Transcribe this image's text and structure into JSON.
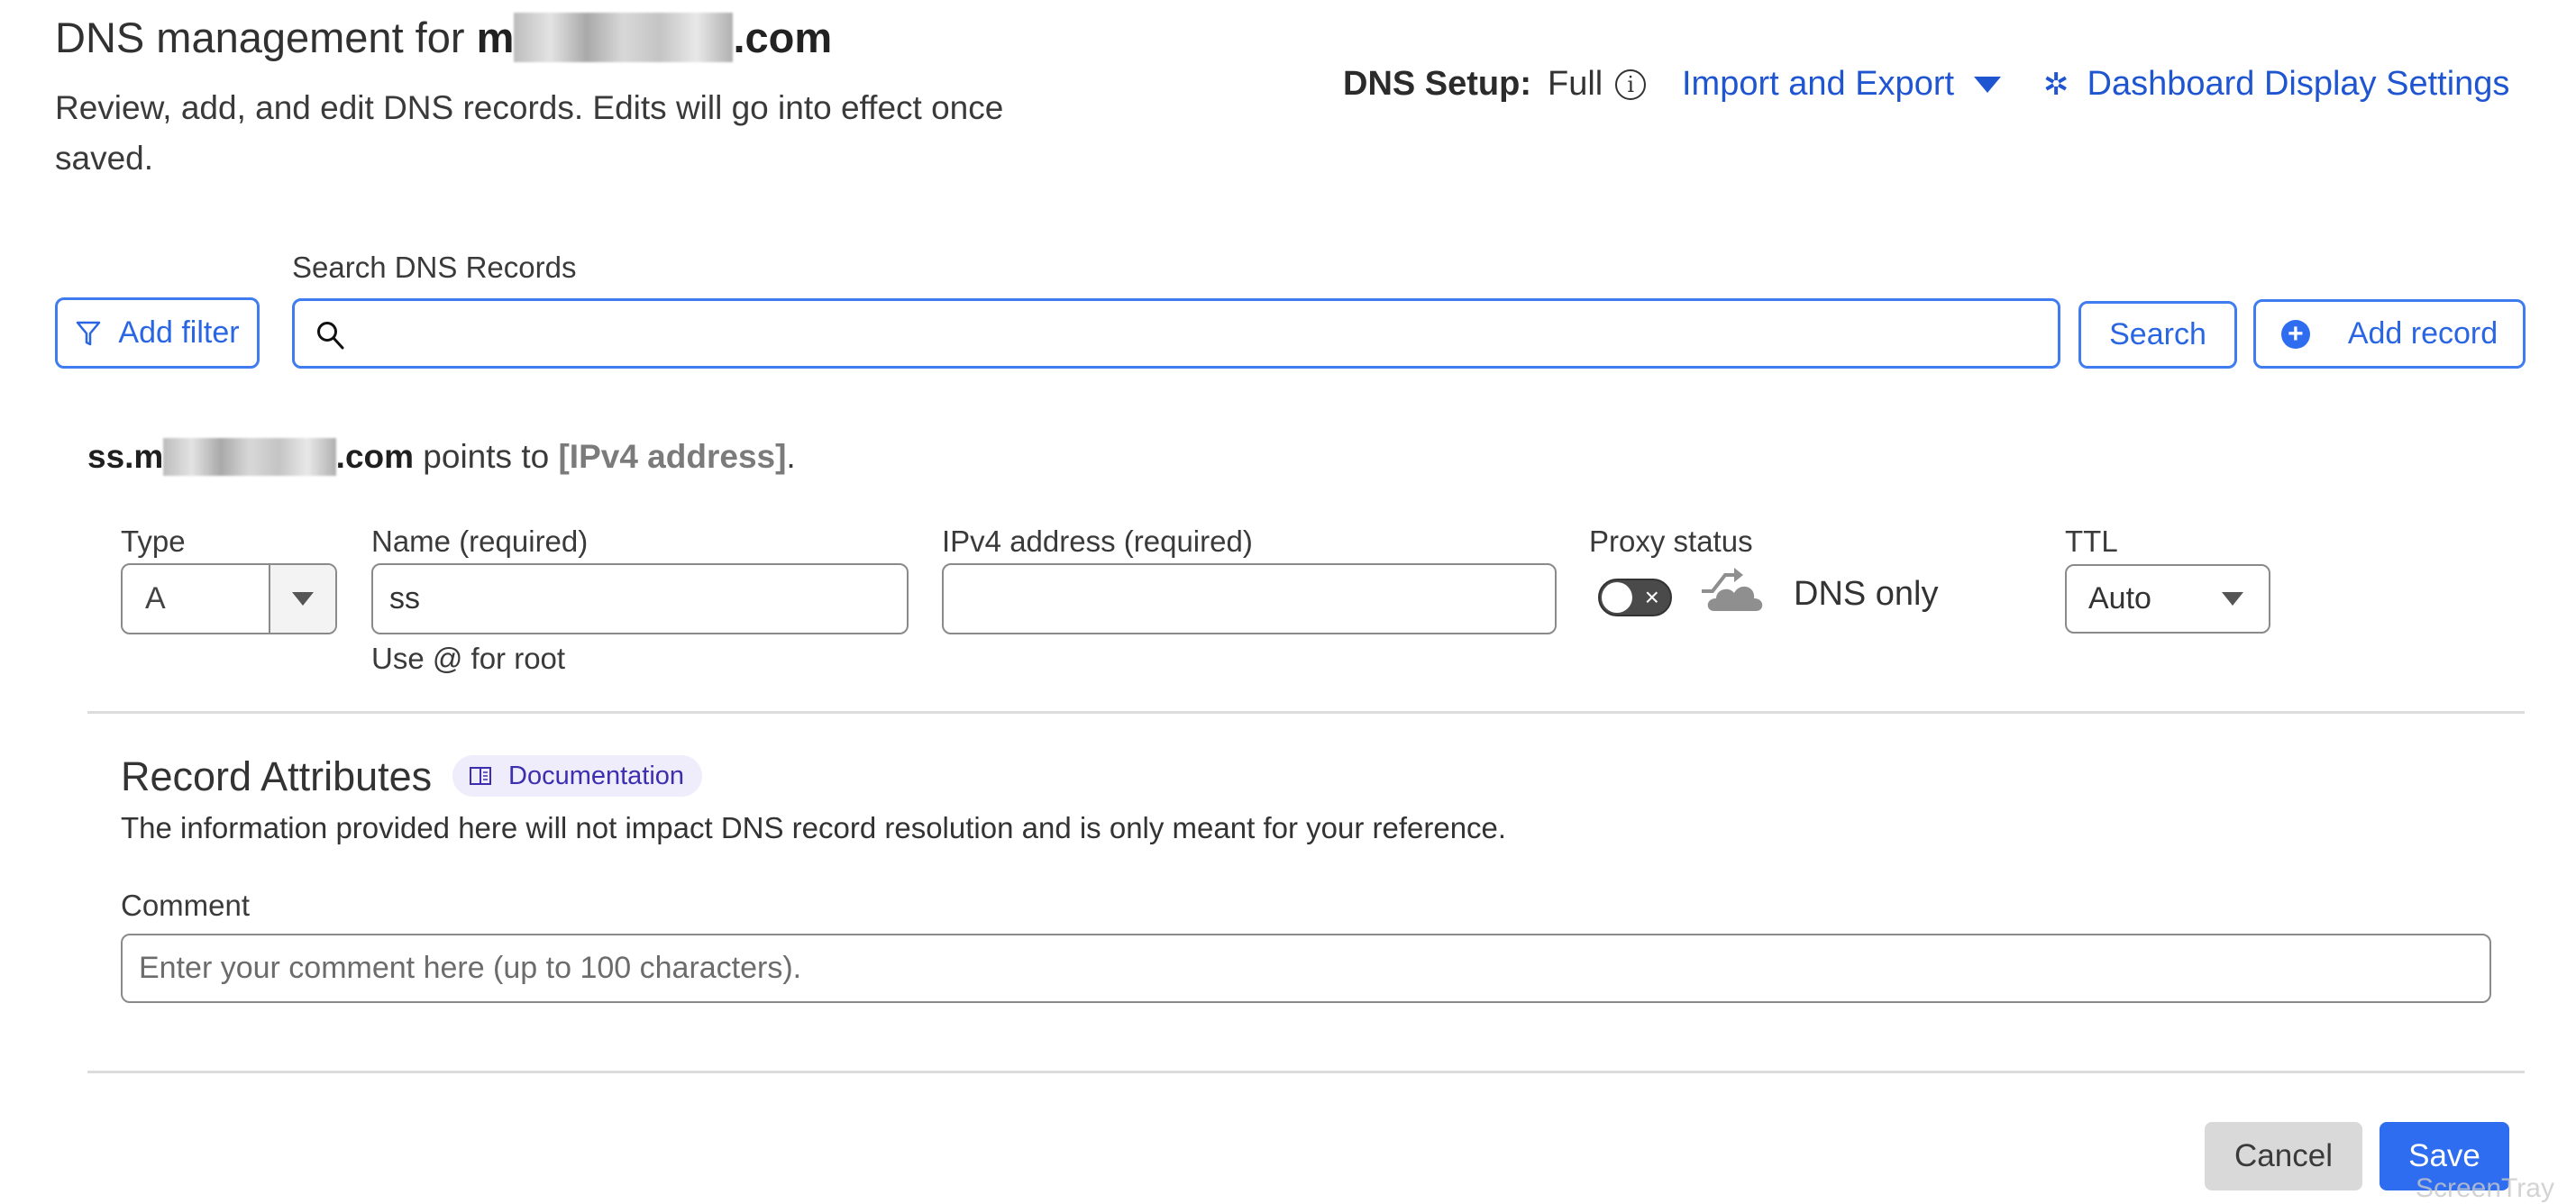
{
  "header": {
    "title_prefix": "DNS management for ",
    "domain_start": "m",
    "domain_redacted": "ercitasavel",
    "domain_end": ".com",
    "subtitle": "Review, add, and edit DNS records. Edits will go into effect once saved.",
    "dns_setup_label": "DNS Setup:",
    "dns_setup_value": "Full",
    "info_icon": "info-circle-icon",
    "import_export_label": "Import and Export",
    "dashboard_settings_label": "Dashboard Display Settings"
  },
  "toolbar": {
    "add_filter_label": "Add filter",
    "search_label": "Search DNS Records",
    "search_value": "",
    "search_button_label": "Search",
    "add_record_label": "Add record"
  },
  "record_form": {
    "summary": {
      "prefix": "ss.m",
      "redacted": "ercitasavel",
      "suffix": ".com",
      "middle": " points to ",
      "placeholder": "[IPv4 address]",
      "end": "."
    },
    "type": {
      "label": "Type",
      "value": "A"
    },
    "name": {
      "label": "Name (required)",
      "value": "ss",
      "hint": "Use @ for root"
    },
    "ipv4": {
      "label": "IPv4 address (required)",
      "value": ""
    },
    "proxy": {
      "label": "Proxy status",
      "enabled": false,
      "status_text": "DNS only"
    },
    "ttl": {
      "label": "TTL",
      "value": "Auto"
    }
  },
  "attributes": {
    "title": "Record Attributes",
    "doc_label": "Documentation",
    "description": "The information provided here will not impact DNS record resolution and is only meant for your reference.",
    "comment_label": "Comment",
    "comment_placeholder": "Enter your comment here (up to 100 characters).",
    "comment_value": ""
  },
  "footer": {
    "cancel_label": "Cancel",
    "save_label": "Save",
    "watermark": "ScreenTray"
  },
  "colors": {
    "accent": "#2f6df0",
    "link": "#1f55d1",
    "badge_bg": "#efedfb",
    "badge_text": "#3b2fb0"
  }
}
